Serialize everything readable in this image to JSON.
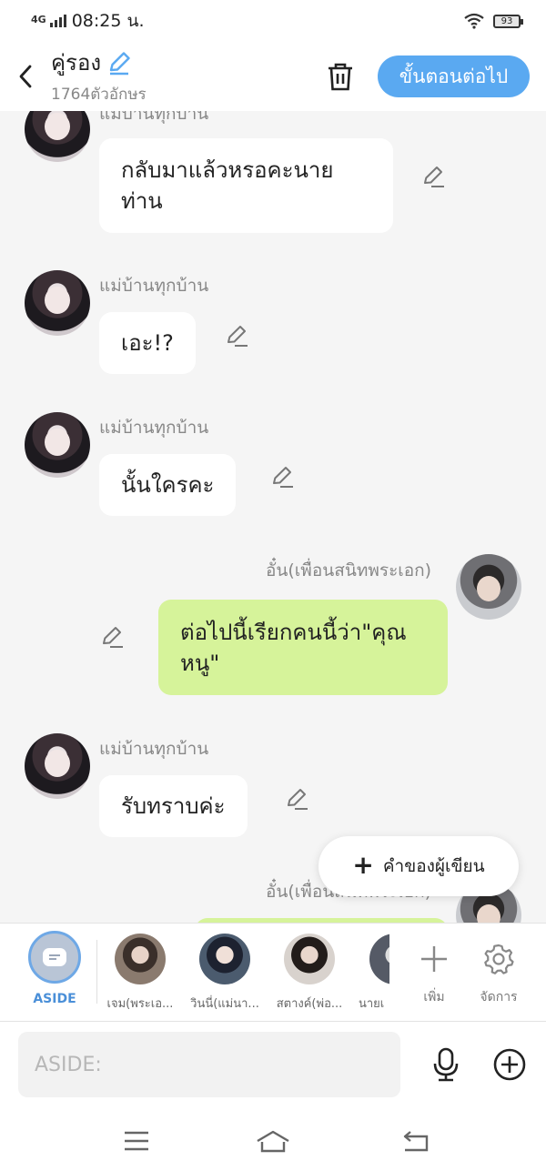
{
  "status": {
    "network": "4G",
    "time": "08:25 น.",
    "battery": "93"
  },
  "header": {
    "title": "คู่รอง",
    "char_count": "1764ตัวอักษร",
    "next_label": "ขั้นตอนต่อไป"
  },
  "messages": [
    {
      "sender": "แม่บ้านทุกบ้าน",
      "line1": "กลับมาแล้วหรอคะนาย",
      "line2": "ท่าน"
    },
    {
      "sender": "แม่บ้านทุกบ้าน",
      "text": "เอะ!?"
    },
    {
      "sender": "แม่บ้านทุกบ้าน",
      "text": "นั้นใครคะ"
    },
    {
      "sender": "อั๋น(เพื่อนสนิทพระเอก)",
      "line1": "ต่อไปนี้เรียกคนนี้ว่า\"คุณ",
      "line2": "หนู\""
    },
    {
      "sender": "แม่บ้านทุกบ้าน",
      "text": "รับทราบค่ะ"
    },
    {
      "sender": "อั๋น(เพื่อนสนิทพระเอก)"
    }
  ],
  "fab": {
    "label": "คำของผู้เขียน"
  },
  "tray": {
    "aside_label": "ASIDE",
    "characters": [
      {
        "name": "เจม(พระเอ..."
      },
      {
        "name": "วินนี่(แม่นา..."
      },
      {
        "name": "สตางค์(พ่อ..."
      },
      {
        "name": "นายเ"
      }
    ],
    "add_label": "เพิ่ม",
    "manage_label": "จัดการ"
  },
  "input": {
    "placeholder": "ASIDE:"
  },
  "colors": {
    "accent": "#5aa9f1",
    "my_bubble": "#d6f39a",
    "background": "#f5f5f5"
  }
}
